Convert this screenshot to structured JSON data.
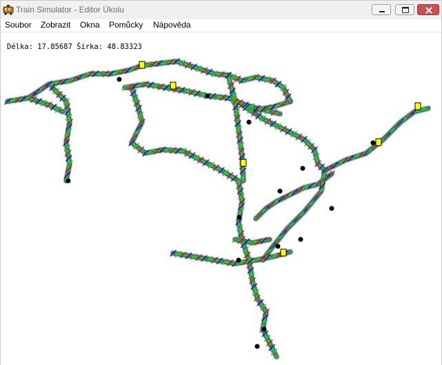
{
  "window": {
    "title": "Train Simulator - Editor Úkolu",
    "controls": [
      "minimize",
      "maximize",
      "close"
    ]
  },
  "menubar": {
    "items": [
      {
        "label": "Soubor"
      },
      {
        "label": "Zobrazit"
      },
      {
        "label": "Okna"
      },
      {
        "label": "Pomůcky"
      },
      {
        "label": "Nápověda"
      }
    ]
  },
  "map": {
    "coordinates_text": "Délka: 17.85687 Šírka: 48.83323",
    "colors": {
      "track": "#28c828",
      "track_secondary": "#1414b4",
      "signal": "#c81414",
      "station": "#000000",
      "tree": "#8a8a8a",
      "marker": "#ffff00"
    }
  }
}
